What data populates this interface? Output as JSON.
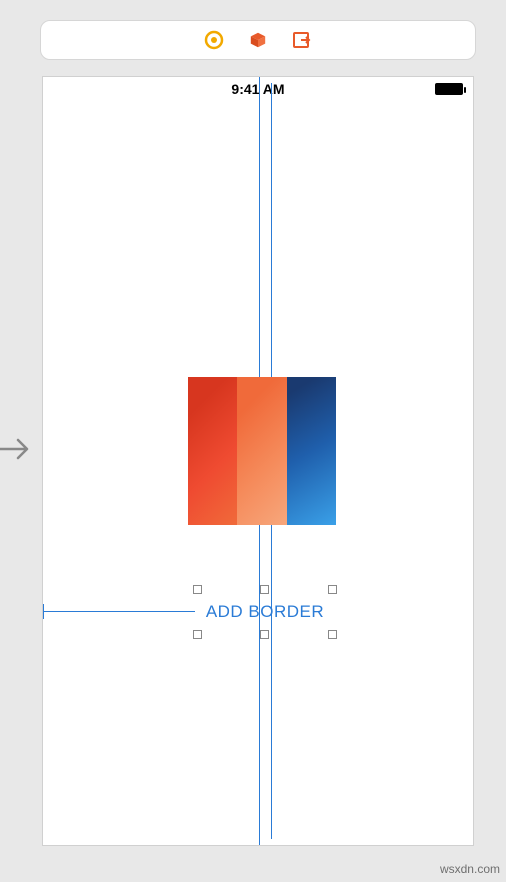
{
  "toolbar": {
    "icons": {
      "record": "record-icon",
      "cube": "cube-icon",
      "exit": "exit-icon"
    }
  },
  "statusbar": {
    "time": "9:41 AM"
  },
  "canvas": {
    "image_semantic": "product-image",
    "button_label": "ADD BORDER"
  },
  "watermark": "wsxdn.com"
}
